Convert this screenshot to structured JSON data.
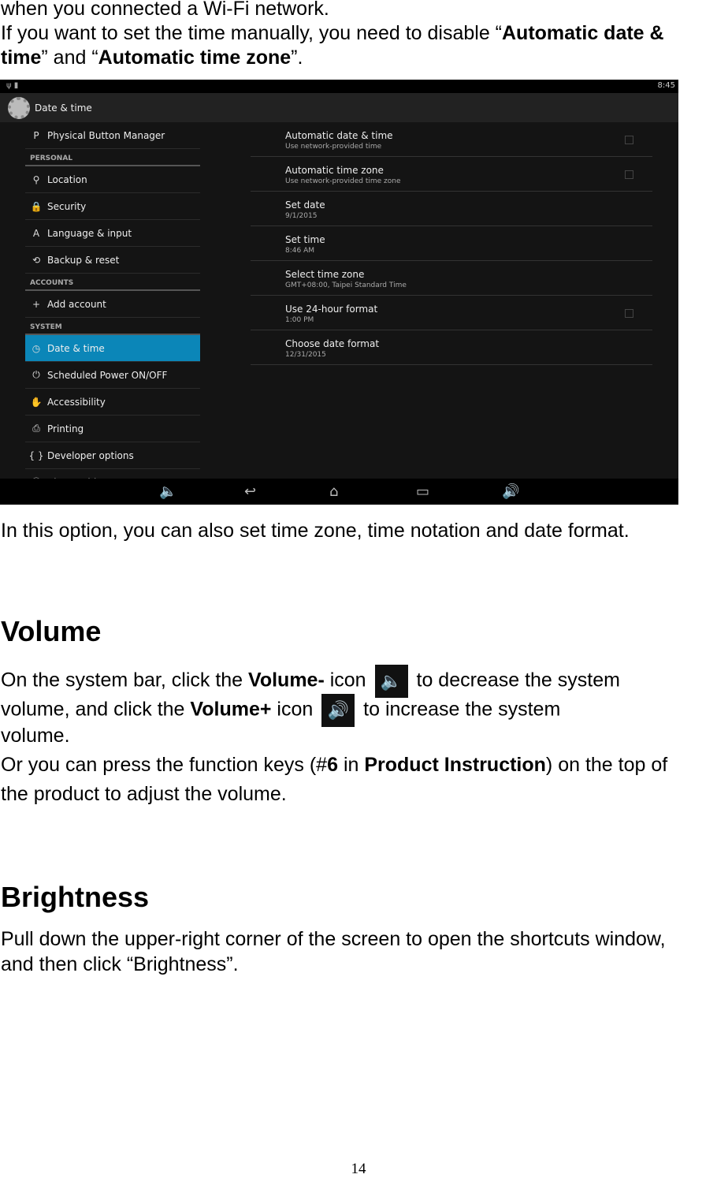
{
  "intro": {
    "line1": "when you connected a Wi-Fi network.",
    "line2_a": "If you want to set the time manually, you need to disable “",
    "line2_b": "Automatic date &",
    "line3_a": "time",
    "line3_b": "” and “",
    "line3_c": "Automatic time zone",
    "line3_d": "”."
  },
  "screen": {
    "clock": "8:45",
    "title": "Date & time",
    "sidebar": [
      {
        "type": "item",
        "icon": "P",
        "label": "Physical Button Manager"
      },
      {
        "type": "cat",
        "label": "PERSONAL"
      },
      {
        "type": "item",
        "icon": "⚲",
        "label": "Location"
      },
      {
        "type": "item",
        "icon": "🔒",
        "label": "Security"
      },
      {
        "type": "item",
        "icon": "A",
        "label": "Language & input"
      },
      {
        "type": "item",
        "icon": "⟲",
        "label": "Backup & reset"
      },
      {
        "type": "cat",
        "label": "ACCOUNTS"
      },
      {
        "type": "item",
        "icon": "+",
        "label": "Add account"
      },
      {
        "type": "cat",
        "label": "SYSTEM"
      },
      {
        "type": "item",
        "icon": "◷",
        "label": "Date & time",
        "selected": true
      },
      {
        "type": "item",
        "icon": "⏻",
        "label": "Scheduled Power ON/OFF"
      },
      {
        "type": "item",
        "icon": "✋",
        "label": "Accessibility"
      },
      {
        "type": "item",
        "icon": "⎙",
        "label": "Printing"
      },
      {
        "type": "item",
        "icon": "{ }",
        "label": "Developer options"
      },
      {
        "type": "item",
        "icon": "ⓘ",
        "label": "About tablet"
      }
    ],
    "settings": [
      {
        "title": "Automatic date & time",
        "summary": "Use network-provided time",
        "checkbox": false
      },
      {
        "title": "Automatic time zone",
        "summary": "Use network-provided time zone",
        "checkbox": false
      },
      {
        "title": "Set date",
        "summary": "9/1/2015"
      },
      {
        "title": "Set time",
        "summary": "8:46 AM"
      },
      {
        "title": "Select time zone",
        "summary": "GMT+08:00, Taipei Standard Time"
      },
      {
        "title": "Use 24-hour format",
        "summary": "1:00 PM",
        "checkbox": false
      },
      {
        "title": "Choose date format",
        "summary": "12/31/2015"
      }
    ],
    "selected_color": "#0b86b8"
  },
  "after_shot": "In this option, you can also set time zone, time notation and date format.",
  "volume": {
    "heading": "Volume",
    "p1a": "On the system bar, click the ",
    "p1b": "Volume-",
    "p1c": " icon ",
    "p1d": " to decrease the system",
    "p2a": "volume, and click the ",
    "p2b": "Volume+",
    "p2c": " icon ",
    "p2d": "  to increase the system",
    "p3": "volume.",
    "p4a": "Or you can press the function keys (#",
    "p4b": "6",
    "p4c": " in ",
    "p4d": "Product Instruction",
    "p4e": ") on the top of",
    "p5": "the product to adjust the volume."
  },
  "brightness": {
    "heading": "Brightness",
    "l1": "Pull down the upper-right corner of the screen to open the shortcuts window,",
    "l2": "and then click “Brightness”."
  },
  "page_number": "14"
}
